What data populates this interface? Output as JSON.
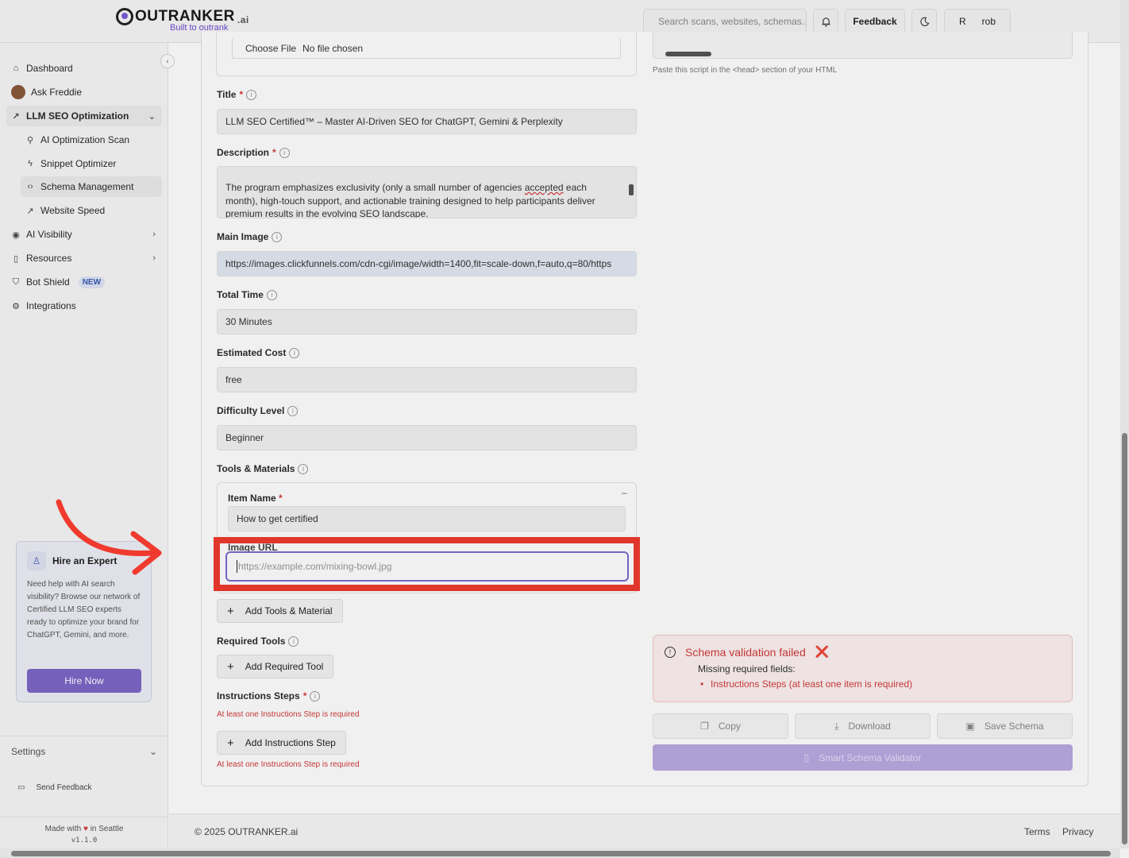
{
  "brand": {
    "name": "OUTRANKER",
    "suffix": ".ai",
    "tagline": "Built to outrank"
  },
  "header": {
    "search_placeholder": "Search scans, websites, schemas...",
    "feedback_label": "Feedback",
    "user_initial": "R",
    "user_name": "rob"
  },
  "sidebar": {
    "items": [
      {
        "label": "Dashboard"
      },
      {
        "label": "Ask Freddie"
      },
      {
        "label": "LLM SEO Optimization"
      },
      {
        "label": "AI Optimization Scan"
      },
      {
        "label": "Snippet Optimizer"
      },
      {
        "label": "Schema Management"
      },
      {
        "label": "Website Speed"
      },
      {
        "label": "AI Visibility"
      },
      {
        "label": "Resources"
      },
      {
        "label": "Bot Shield",
        "badge": "NEW"
      },
      {
        "label": "Integrations"
      }
    ],
    "hire": {
      "title": "Hire an Expert",
      "text": "Need help with AI search visibility? Browse our network of Certified LLM SEO experts ready to optimize your brand for ChatGPT, Gemini, and more.",
      "button": "Hire Now"
    },
    "settings_label": "Settings",
    "send_feedback": "Send Feedback",
    "made_with_1": "Made with",
    "made_with_2": "in Seattle",
    "version": "v1.1.0"
  },
  "form": {
    "file_button": "Choose File",
    "file_status": "No file chosen",
    "title_label": "Title",
    "title_value": "LLM SEO Certified™ – Master AI-Driven SEO for ChatGPT, Gemini & Perplexity",
    "description_label": "Description",
    "description_value_1": "The program emphasizes exclusivity (only a small number of agencies",
    "description_value_underlined": "accepted",
    "description_value_2": "each month), high-touch support, and actionable training designed to help participants deliver premium results in the evolving SEO landscape.",
    "main_image_label": "Main Image",
    "main_image_value": "https://images.clickfunnels.com/cdn-cgi/image/width=1400,fit=scale-down,f=auto,q=80/https",
    "total_time_label": "Total Time",
    "total_time_value": "30 Minutes",
    "estimated_cost_label": "Estimated Cost",
    "estimated_cost_value": "free",
    "difficulty_label": "Difficulty Level",
    "difficulty_value": "Beginner",
    "tools_label": "Tools & Materials",
    "item_name_label": "Item Name",
    "item_name_value": "How to get certified",
    "image_url_label": "Image URL",
    "image_url_placeholder": "https://example.com/mixing-bowl.jpg",
    "add_tools_label": "Add Tools & Material",
    "required_tools_label": "Required Tools",
    "add_required_tool_label": "Add Required Tool",
    "instructions_label": "Instructions Steps",
    "instructions_error": "At least one Instructions Step is required",
    "add_instruction_label": "Add Instructions Step"
  },
  "right": {
    "code_hint": "Paste this script in the <head> section of your HTML",
    "validation_title": "Schema validation failed",
    "validation_mark": "❌",
    "missing_label": "Missing required fields:",
    "missing_items": [
      "Instructions Steps (at least one item is required)"
    ],
    "copy_label": "Copy",
    "download_label": "Download",
    "save_label": "Save Schema",
    "smart_label": "Smart Schema Validator"
  },
  "footer": {
    "copyright": "© 2025 OUTRANKER.ai",
    "terms": "Terms",
    "privacy": "Privacy"
  },
  "colors": {
    "accent": "#7d68c8",
    "error": "#d23a3a",
    "highlight": "#f03a2e"
  }
}
